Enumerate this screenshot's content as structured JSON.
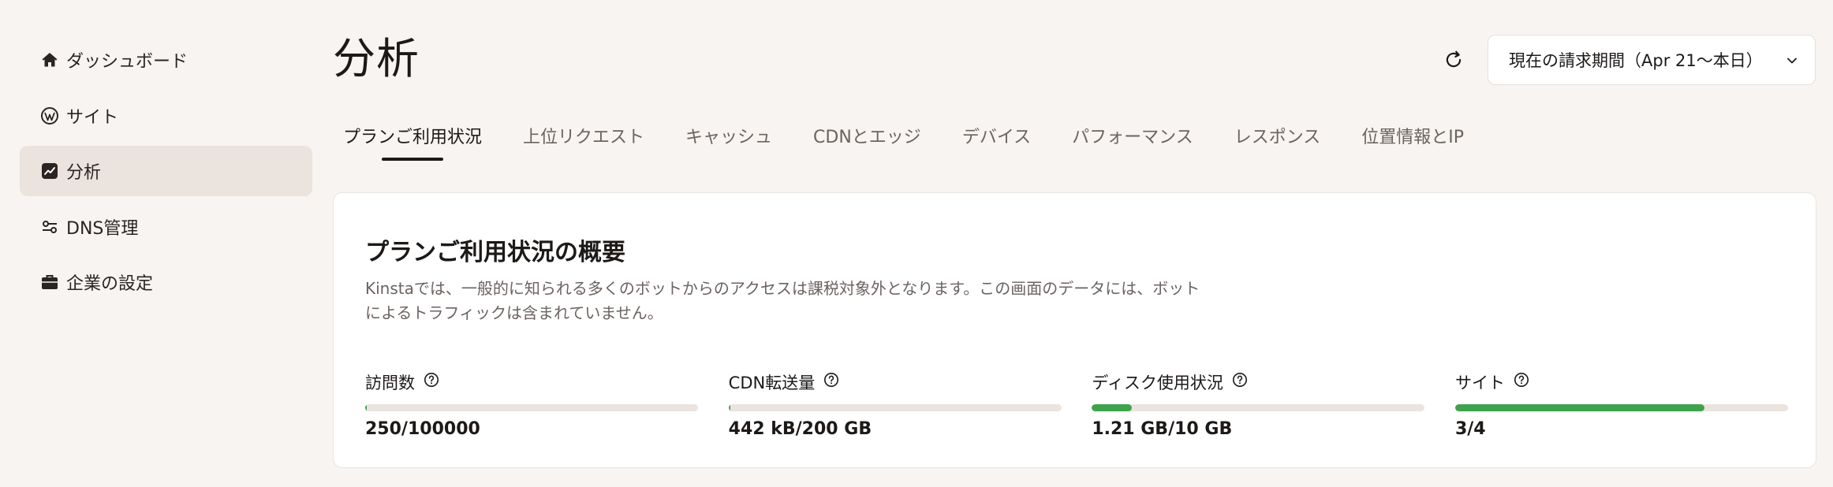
{
  "sidebar": {
    "items": [
      {
        "label": "ダッシュボード",
        "icon": "home-icon",
        "active": false
      },
      {
        "label": "サイト",
        "icon": "wordpress-icon",
        "active": false
      },
      {
        "label": "分析",
        "icon": "analytics-icon",
        "active": true
      },
      {
        "label": "DNS管理",
        "icon": "dns-icon",
        "active": false
      },
      {
        "label": "企業の設定",
        "icon": "briefcase-icon",
        "active": false
      }
    ]
  },
  "header": {
    "title": "分析",
    "refresh_icon": "refresh-icon",
    "period": "現在の請求期間（Apr 21〜本日）"
  },
  "tabs": [
    {
      "label": "プランご利用状況",
      "active": true
    },
    {
      "label": "上位リクエスト",
      "active": false
    },
    {
      "label": "キャッシュ",
      "active": false
    },
    {
      "label": "CDNとエッジ",
      "active": false
    },
    {
      "label": "デバイス",
      "active": false
    },
    {
      "label": "パフォーマンス",
      "active": false
    },
    {
      "label": "レスポンス",
      "active": false
    },
    {
      "label": "位置情報とIP",
      "active": false
    }
  ],
  "overview": {
    "title": "プランご利用状況の概要",
    "description": "Kinstaでは、一般的に知られる多くのボットからのアクセスは課税対象外となります。この画面のデータには、ボットによるトラフィックは含まれていません。",
    "metrics": [
      {
        "label": "訪問数",
        "value": "250/100000",
        "progress": 0.0025
      },
      {
        "label": "CDN転送量",
        "value": "442 kB/200 GB",
        "progress": 0.0
      },
      {
        "label": "ディスク使用状況",
        "value": "1.21 GB/10 GB",
        "progress": 0.121
      },
      {
        "label": "サイト",
        "value": "3/4",
        "progress": 0.75
      }
    ]
  },
  "colors": {
    "background": "#f7f4f1",
    "active_nav": "#ebe3dd",
    "progress_fill": "#3ea34c",
    "progress_track": "#ebe4de",
    "text": "#1c1917",
    "muted_text": "#6b6360"
  }
}
